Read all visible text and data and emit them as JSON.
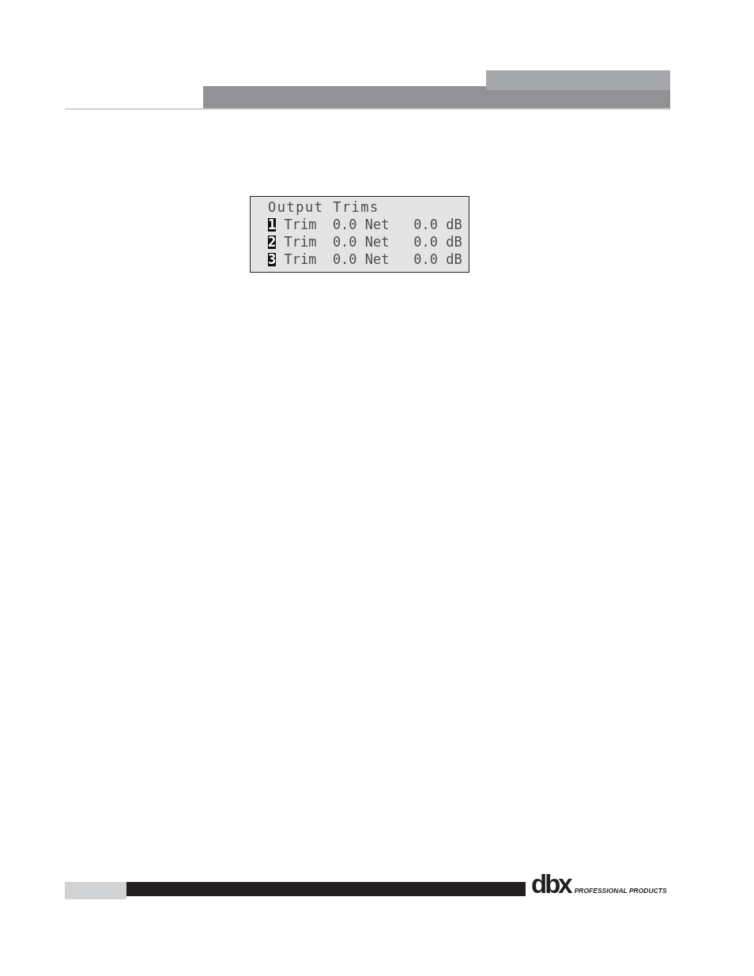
{
  "lcd": {
    "title": "Output Trims",
    "rows": [
      {
        "channel": "1",
        "label": "Trim",
        "trim": "0.0",
        "net_label": "Net",
        "net": "0.0",
        "unit": "dB"
      },
      {
        "channel": "2",
        "label": "Trim",
        "trim": "0.0",
        "net_label": "Net",
        "net": "0.0",
        "unit": "dB"
      },
      {
        "channel": "3",
        "label": "Trim",
        "trim": "0.0",
        "net_label": "Net",
        "net": "0.0",
        "unit": "dB"
      }
    ]
  },
  "footer": {
    "logo": "dbx",
    "tagline": "PROFESSIONAL PRODUCTS"
  }
}
